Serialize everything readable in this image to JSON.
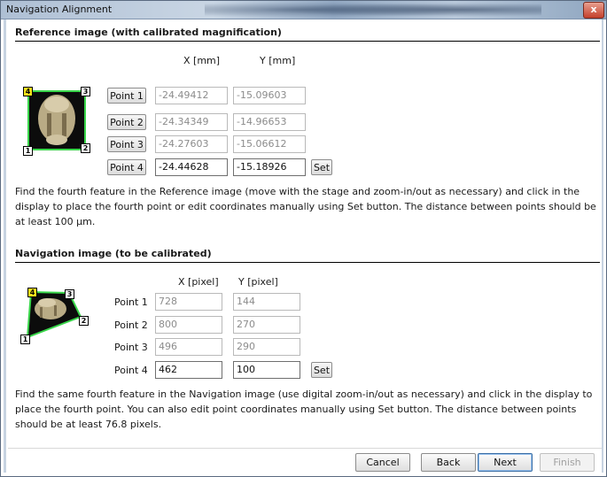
{
  "window": {
    "title": "Navigation Alignment",
    "close_glyph": "x"
  },
  "reference": {
    "heading": "Reference image (with calibrated magnification)",
    "col_x": "X [mm]",
    "col_y": "Y [mm]",
    "points": [
      {
        "label": "Point 1",
        "x": "-24.49412",
        "y": "-15.09603"
      },
      {
        "label": "Point 2",
        "x": "-24.34349",
        "y": "-14.96653"
      },
      {
        "label": "Point 3",
        "x": "-24.27603",
        "y": "-15.06612"
      },
      {
        "label": "Point 4",
        "x": "-24.44628",
        "y": "-15.18926"
      }
    ],
    "set_label": "Set",
    "corner_labels": [
      "4",
      "3",
      "1",
      "2"
    ],
    "instructions": "Find the fourth feature in the Reference image (move with the stage and zoom-in/out as necessary) and click in the display to place the fourth point or edit coordinates manually using Set button. The distance between points should be at least 100 µm."
  },
  "navigation": {
    "heading": "Navigation image (to be calibrated)",
    "col_x": "X [pixel]",
    "col_y": "Y [pixel]",
    "points": [
      {
        "label": "Point 1",
        "x": "728",
        "y": "144"
      },
      {
        "label": "Point 2",
        "x": "800",
        "y": "270"
      },
      {
        "label": "Point 3",
        "x": "496",
        "y": "290"
      },
      {
        "label": "Point 4",
        "x": "462",
        "y": "100"
      }
    ],
    "set_label": "Set",
    "corner_labels": [
      "4",
      "3",
      "2",
      "1"
    ],
    "instructions": "Find the same fourth feature in the Navigation image (use digital zoom-in/out as necessary) and click in the display to place the fourth point. You can also edit point coordinates manually using Set button. The distance between points should be at least 76.8 pixels."
  },
  "footer": {
    "cancel": "Cancel",
    "back": "Back",
    "next": "Next",
    "finish": "Finish"
  }
}
